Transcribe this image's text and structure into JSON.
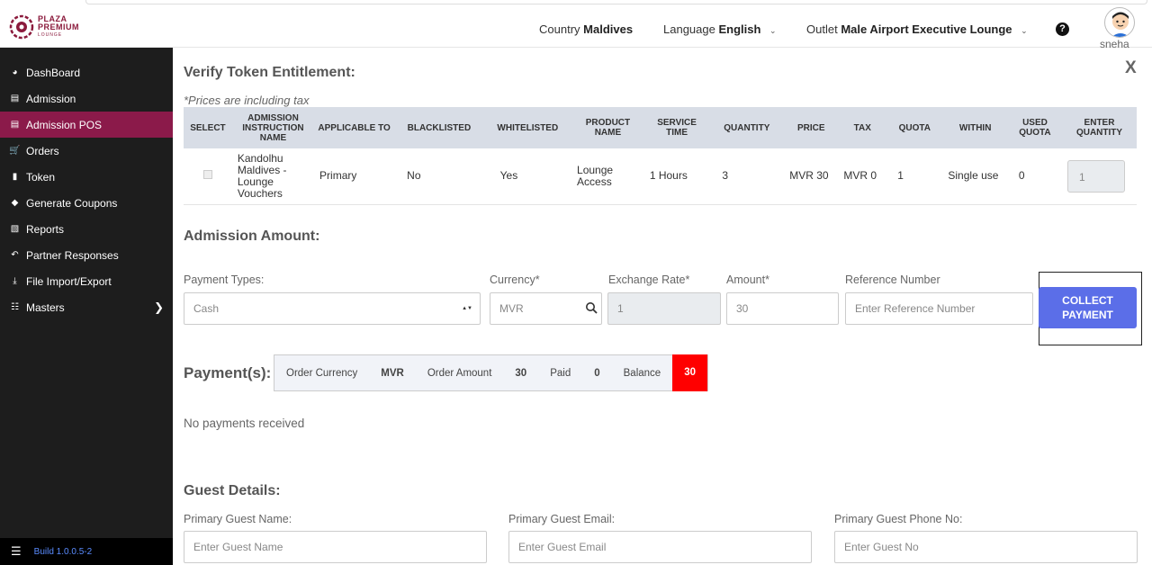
{
  "header": {
    "logo_line1": "PLAZA",
    "logo_line2": "PREMIUM",
    "logo_line3": "LOUNGE",
    "country_label": "Country",
    "country_value": "Maldives",
    "language_label": "Language",
    "language_value": "English",
    "outlet_label": "Outlet",
    "outlet_value": "Male Airport Executive Lounge",
    "help_icon": "?",
    "username": "sneha"
  },
  "sidebar": {
    "items": [
      {
        "label": "DashBoard",
        "icon": "dashboard-icon"
      },
      {
        "label": "Admission",
        "icon": "id-card-icon"
      },
      {
        "label": "Admission POS",
        "icon": "id-card-icon"
      },
      {
        "label": "Orders",
        "icon": "cart-icon"
      },
      {
        "label": "Token",
        "icon": "file-icon"
      },
      {
        "label": "Generate Coupons",
        "icon": "tag-icon"
      },
      {
        "label": "Reports",
        "icon": "book-icon"
      },
      {
        "label": "Partner Responses",
        "icon": "reply-icon"
      },
      {
        "label": "File Import/Export",
        "icon": "download-icon"
      },
      {
        "label": "Masters",
        "icon": "sitemap-icon"
      }
    ],
    "footer_build": "Build 1.0.0.5-2",
    "accent": "#8b1a4a"
  },
  "main": {
    "verify_title": "Verify Token Entitlement:",
    "close_label": "X",
    "price_note": "*Prices are including tax",
    "table": {
      "headers": [
        "SELECT",
        "ADMISSION INSTRUCTION NAME",
        "APPLICABLE TO",
        "BLACKLISTED",
        "WHITELISTED",
        "PRODUCT NAME",
        "SERVICE TIME",
        "QUANTITY",
        "PRICE",
        "TAX",
        "QUOTA",
        "WITHIN",
        "USED QUOTA",
        "ENTER QUANTITY"
      ],
      "row": {
        "instruction": "Kandolhu Maldives - Lounge Vouchers",
        "applicable": "Primary",
        "blacklisted": "No",
        "whitelisted": "Yes",
        "product": "Lounge Access",
        "service_time": "1 Hours",
        "quantity": "3",
        "price": "MVR 30",
        "tax": "MVR 0",
        "quota": "1",
        "within": "Single use",
        "used_quota": "0",
        "enter_quantity": "1"
      }
    },
    "admission_title": "Admission Amount:",
    "payment_types_label": "Payment Types:",
    "payment_type_value": "Cash",
    "currency_label": "Currency*",
    "currency_value": "MVR",
    "exchange_label": "Exchange Rate*",
    "exchange_value": "1",
    "amount_label": "Amount*",
    "amount_value": "30",
    "reference_label": "Reference Number",
    "reference_placeholder": "Enter Reference Number",
    "collect_line1": "COLLECT",
    "collect_line2": "PAYMENT",
    "payments_title": "Payment(s):",
    "summary": {
      "order_currency_label": "Order Currency",
      "order_currency_value": "MVR",
      "order_amount_label": "Order Amount",
      "order_amount_value": "30",
      "paid_label": "Paid",
      "paid_value": "0",
      "balance_label": "Balance",
      "balance_value": "30"
    },
    "no_payments": "No payments received",
    "guest_title": "Guest Details:",
    "guest_name_label": "Primary Guest Name:",
    "guest_name_placeholder": "Enter Guest Name",
    "guest_email_label": "Primary Guest Email:",
    "guest_email_placeholder": "Enter Guest Email",
    "guest_phone_label": "Primary Guest Phone No:",
    "guest_phone_placeholder": "Enter Guest No"
  }
}
